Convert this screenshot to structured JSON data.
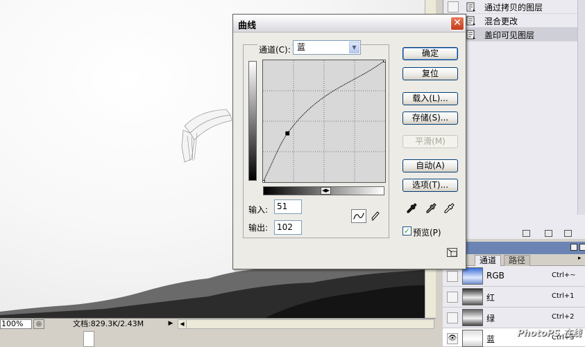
{
  "dialog": {
    "title": "曲线",
    "channel_label": "通道(C):",
    "channel_value": "蓝",
    "input_label": "输入:",
    "input_value": "51",
    "output_label": "输出:",
    "output_value": "102",
    "buttons": {
      "ok": "确定",
      "reset": "复位",
      "load": "载入(L)...",
      "save": "存储(S)...",
      "smooth": "平滑(M)",
      "auto": "自动(A)",
      "options": "选项(T)..."
    },
    "preview_label": "预览(P)",
    "preview_checked": true,
    "curve": {
      "input_range": [
        0,
        255
      ],
      "output_range": [
        0,
        255
      ],
      "points": [
        [
          0,
          0
        ],
        [
          51,
          102
        ],
        [
          255,
          255
        ]
      ],
      "selected_point": [
        51,
        102
      ],
      "grid_divisions": 4
    }
  },
  "history": {
    "items": [
      {
        "label": "通过拷贝的图层",
        "active": false
      },
      {
        "label": "混合更改",
        "active": false
      },
      {
        "label": "盖印可见图层",
        "active": true
      }
    ]
  },
  "channels_panel": {
    "tabs": [
      {
        "label": "通道",
        "active": true
      },
      {
        "label": "路径",
        "active": false
      }
    ],
    "channels": [
      {
        "name": "RGB",
        "shortcut": "Ctrl+~",
        "visible": false,
        "selected": false
      },
      {
        "name": "红",
        "shortcut": "Ctrl+1",
        "visible": false,
        "selected": false
      },
      {
        "name": "绿",
        "shortcut": "Ctrl+2",
        "visible": false,
        "selected": false
      },
      {
        "name": "蓝",
        "shortcut": "Ctrl+3",
        "visible": true,
        "selected": true
      }
    ]
  },
  "statusbar": {
    "zoom": "100%",
    "doc_info": "文档:829.3K/2.43M"
  },
  "watermark": "PhotoPS 在线",
  "colors": {
    "accent": "#003c74",
    "close_button": "#c23c18",
    "panel_bg": "#ebeaf0",
    "dialog_bg": "#ecebe6",
    "channels_bar": "#6b84b4"
  }
}
